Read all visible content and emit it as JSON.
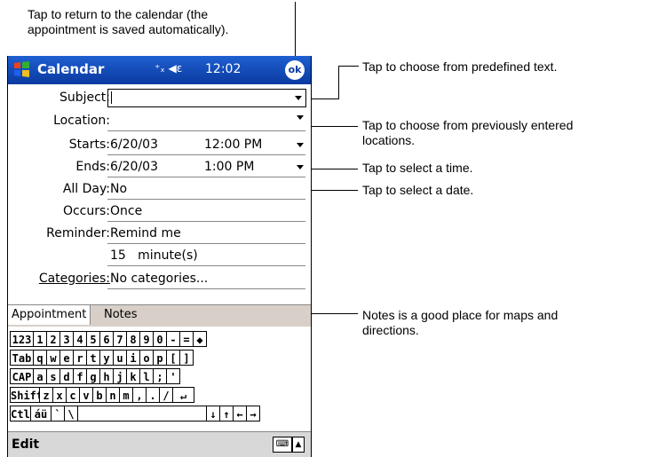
{
  "annotations": {
    "top": "Tap to return to the calendar (the\nappointment is saved automatically).",
    "predefined": "Tap to choose from predefined text.",
    "locations": "Tap to choose from previously entered\nlocations.",
    "time": "Tap to select a time.",
    "date": "Tap to select a date.",
    "notes": "Notes is a good place for maps and\ndirections."
  },
  "titlebar": {
    "app_name": "Calendar",
    "status_icons": "⁺ₓ ◀ε",
    "time": "12:02",
    "ok_label": "ok"
  },
  "form": {
    "subject_label": "Subject:",
    "location_label": "Location:",
    "starts_label": "Starts:",
    "starts_date": "6/20/03",
    "starts_time": "12:00 PM",
    "ends_label": "Ends:",
    "ends_date": "6/20/03",
    "ends_time": "1:00 PM",
    "allday_label": "All Day:",
    "allday_value": "No",
    "occurs_label": "Occurs:",
    "occurs_value": "Once",
    "reminder_label": "Reminder:",
    "reminder_value": "Remind me",
    "reminder_minutes": "15   minute(s)",
    "categories_label": "Categories:",
    "categories_value": "No categories..."
  },
  "tabs": {
    "appointment": "Appointment",
    "notes": "Notes"
  },
  "keyboard": {
    "row1": [
      "123",
      "1",
      "2",
      "3",
      "4",
      "5",
      "6",
      "7",
      "8",
      "9",
      "0",
      "-",
      "=",
      "◆"
    ],
    "row2": [
      "Tab",
      "q",
      "w",
      "e",
      "r",
      "t",
      "y",
      "u",
      "i",
      "o",
      "p",
      "[",
      "]"
    ],
    "row3": [
      "CAP",
      "a",
      "s",
      "d",
      "f",
      "g",
      "h",
      "j",
      "k",
      "l",
      ";",
      "'"
    ],
    "row4": [
      "Shift",
      "z",
      "x",
      "c",
      "v",
      "b",
      "n",
      "m",
      ",",
      ".",
      "/",
      "↵"
    ],
    "row5": [
      "Ctl",
      "áü",
      "`",
      "\\",
      "",
      "↓",
      "↑",
      "←",
      "→"
    ]
  },
  "menubar": {
    "edit": "Edit",
    "keyboard_icon": "⌨",
    "up_arrow": "▲"
  }
}
